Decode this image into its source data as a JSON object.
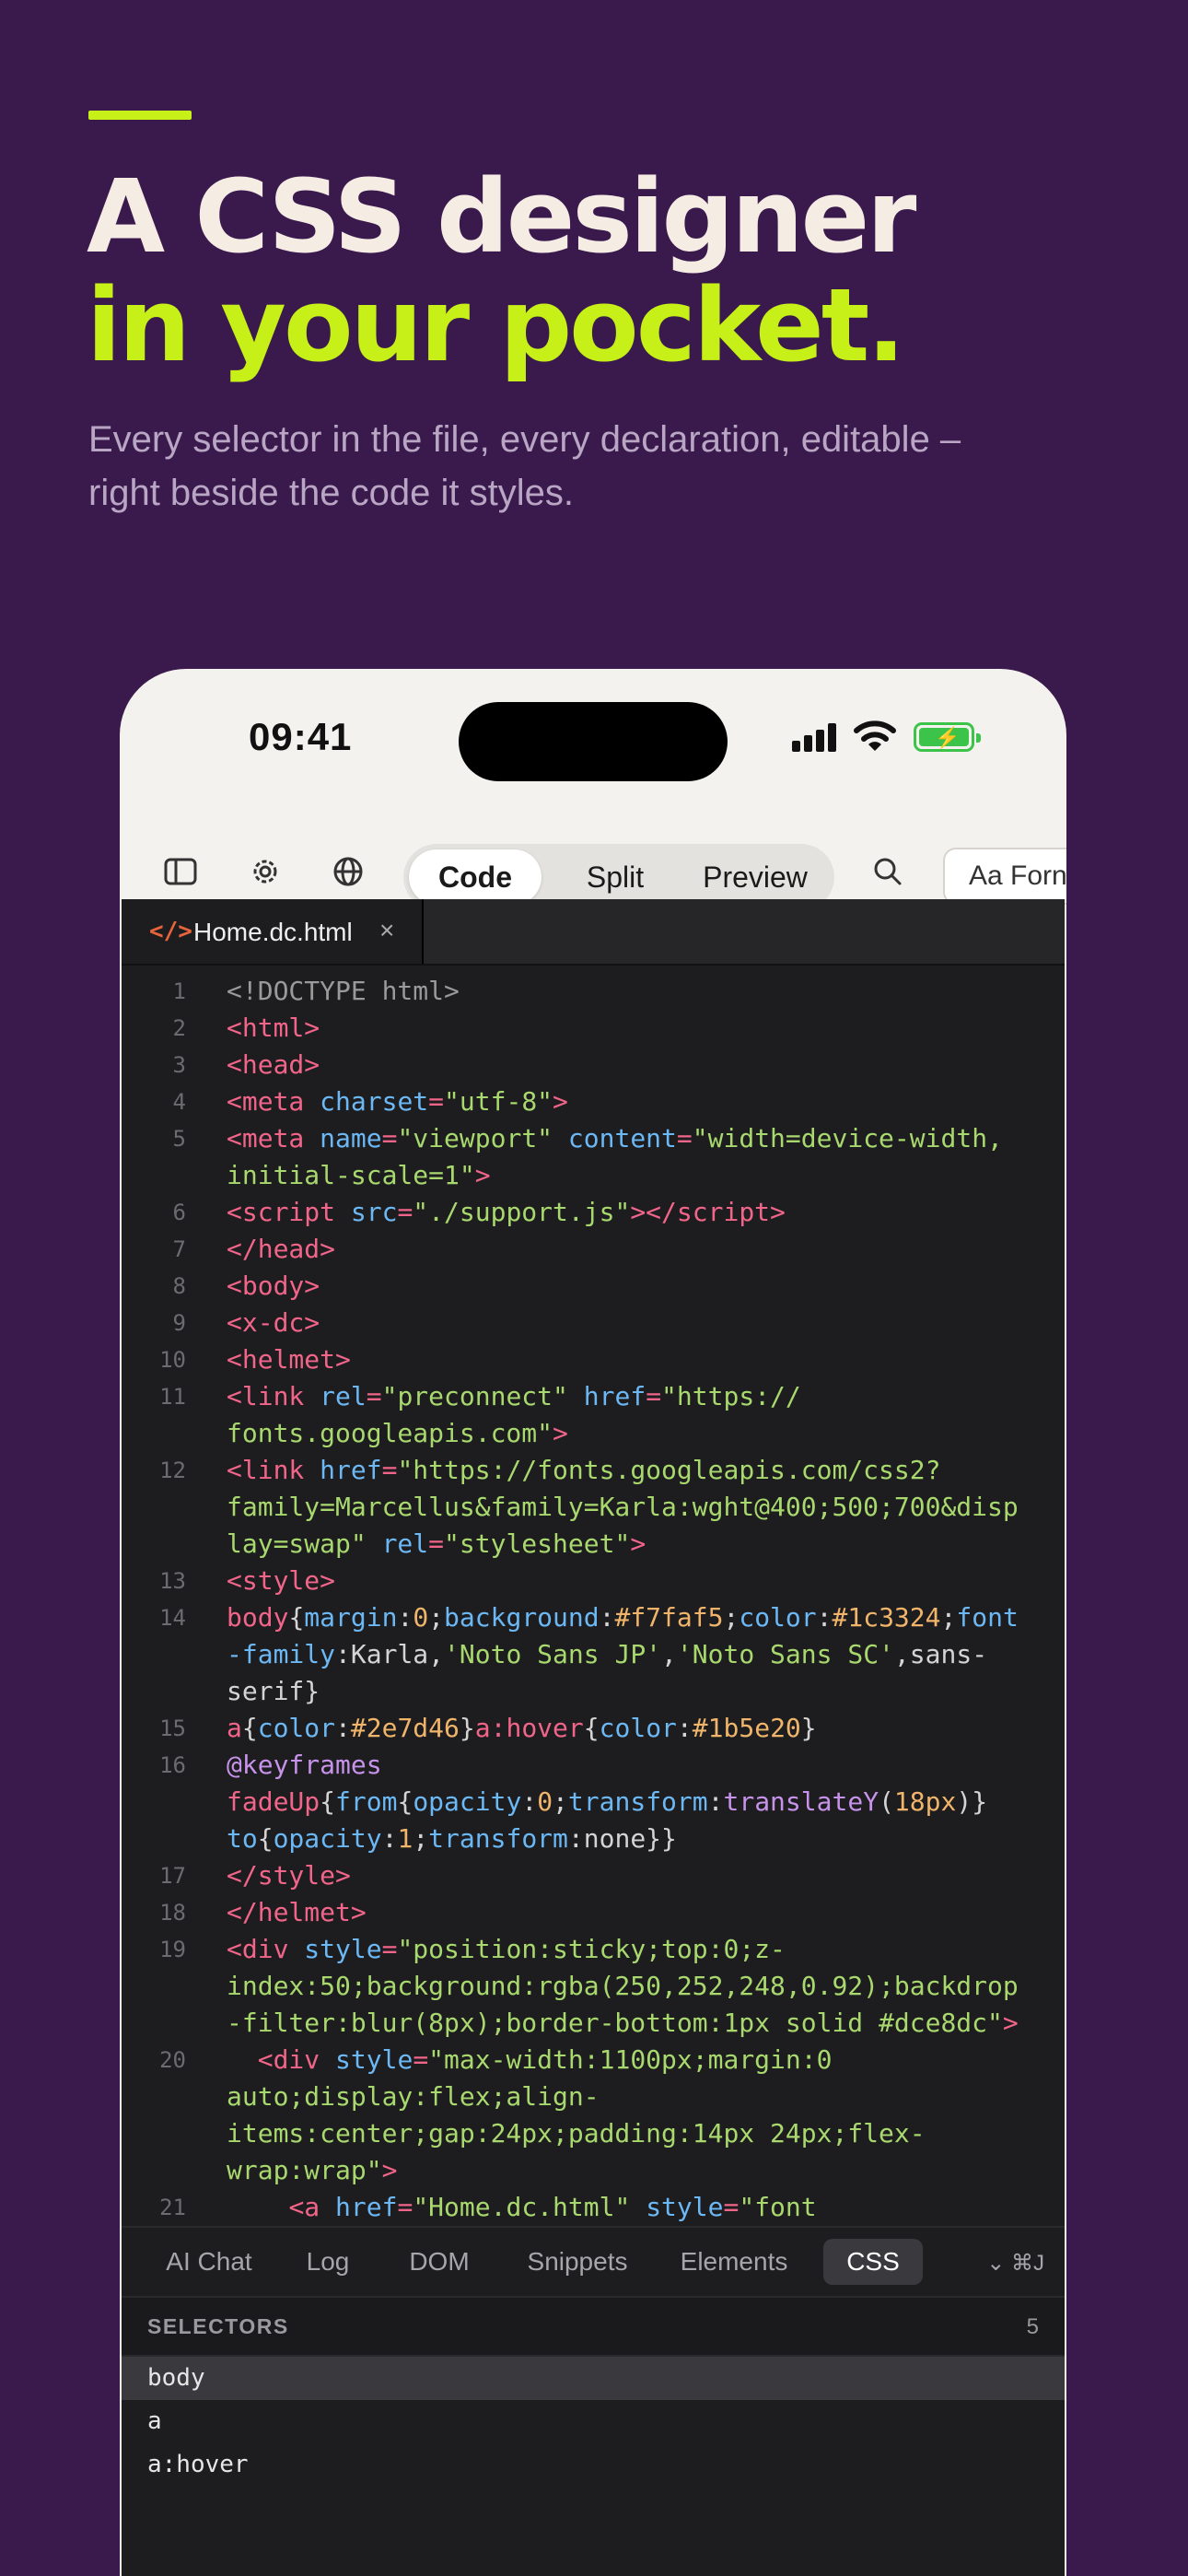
{
  "hero": {
    "title_line1": "A CSS designer",
    "title_line2": "in your pocket.",
    "subtitle_line1": "Every selector in the file, every declaration, editable –",
    "subtitle_line2": "right beside the code it styles.",
    "accent_color": "#c6f018"
  },
  "status_bar": {
    "time": "09:41",
    "icons": [
      "signal-icon",
      "wifi-icon",
      "battery-charging-icon"
    ]
  },
  "toolbar": {
    "icons": [
      "sidebar-icon",
      "gear-icon",
      "globe-icon",
      "search-icon"
    ],
    "segments": [
      "Code",
      "Split",
      "Preview"
    ],
    "active_segment": "Code",
    "format_label": "Aa Forn"
  },
  "editor": {
    "file_icon": "</>",
    "file_name": "Home.dc.html",
    "close_glyph": "×",
    "line_numbers": [
      "1",
      "2",
      "3",
      "4",
      "5",
      "6",
      "7",
      "8",
      "9",
      "10",
      "11",
      "12",
      "13",
      "14",
      "15",
      "16",
      "17",
      "18",
      "19",
      "20"
    ]
  },
  "panel": {
    "tabs": [
      "AI Chat",
      "Log",
      "DOM",
      "Snippets",
      "Elements",
      "CSS"
    ],
    "active_tab": "CSS",
    "shortcut": "⌄ ⌘J",
    "selectors_label": "SELECTORS",
    "selectors_count": "5",
    "selectors": [
      "body",
      "a",
      "a:hover"
    ]
  }
}
